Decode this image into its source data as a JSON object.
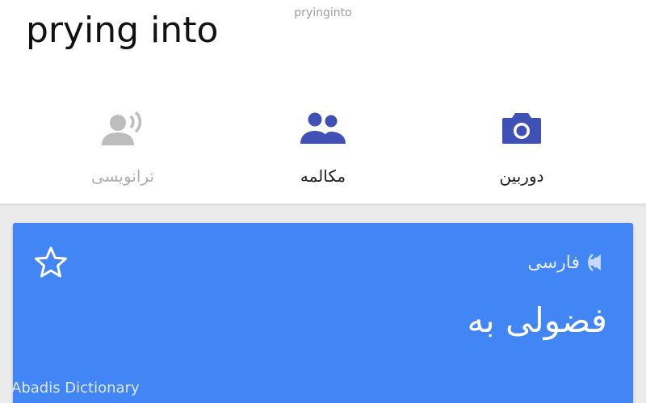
{
  "watermark_top": "pryinginto",
  "source_text": "prying into",
  "actions": {
    "transcribe": "ترانویسی",
    "conversation": "مکالمه",
    "camera": "دوربین"
  },
  "card": {
    "language": "فارسی",
    "translation": "فضولی به"
  },
  "watermark_bottom": "Abadis Dictionary",
  "colors": {
    "accent": "#3f51b5",
    "card": "#4285f4",
    "disabled": "#bdbdbd"
  },
  "icons": {
    "transcribe": "person-voice-icon",
    "conversation": "people-icon",
    "camera": "camera-icon",
    "star": "star-outline-icon",
    "speaker": "speaker-icon"
  }
}
